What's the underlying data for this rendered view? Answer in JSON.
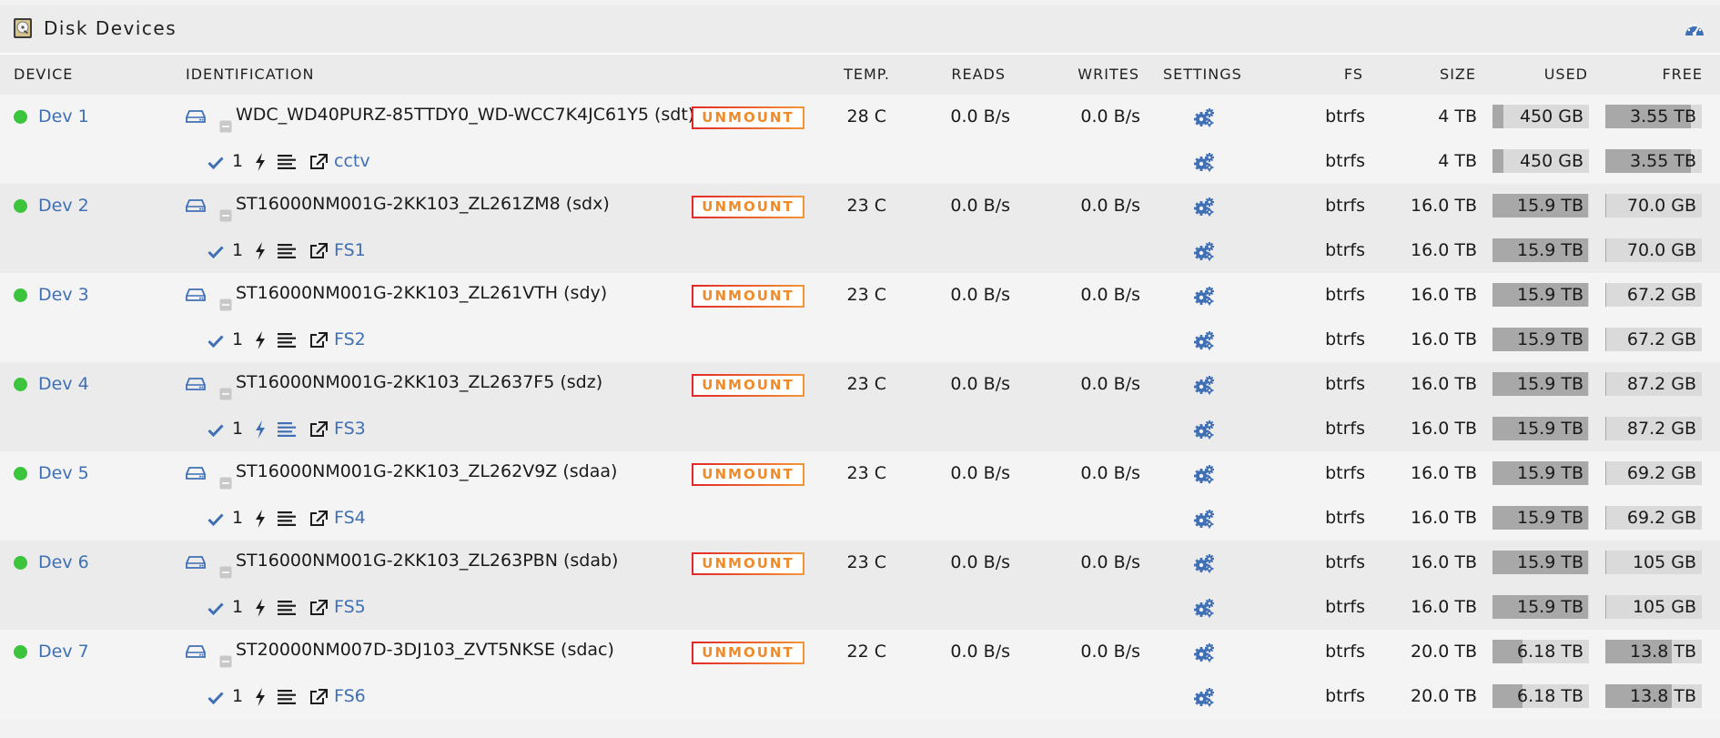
{
  "panel": {
    "title": "Disk Devices"
  },
  "columns": {
    "device": "DEVICE",
    "identification": "IDENTIFICATION",
    "temp": "TEMP.",
    "reads": "READS",
    "writes": "WRITES",
    "settings": "SETTINGS",
    "fs": "FS",
    "size": "SIZE",
    "used": "USED",
    "free": "FREE"
  },
  "colors": {
    "accent": "#3f6fb5",
    "online": "#3cc43c",
    "unmount_start": "#e22828",
    "unmount_end": "#f39636"
  },
  "devices": [
    {
      "name": "Dev 1",
      "identification": "WDC_WD40PURZ-85TTDY0_WD-WCC7K4JC61Y5 (sdt)",
      "action": "UNMOUNT",
      "temp": "28 C",
      "reads": "0.0 B/s",
      "writes": "0.0 B/s",
      "fs": "btrfs",
      "size": "4 TB",
      "used": "450 GB",
      "used_fraction": 0.11,
      "free": "3.55 TB",
      "free_fraction": 0.89,
      "share": {
        "count": "1",
        "name": "cctv",
        "fs": "btrfs",
        "size": "4 TB",
        "used": "450 GB",
        "free": "3.55 TB"
      }
    },
    {
      "name": "Dev 2",
      "identification": "ST16000NM001G-2KK103_ZL261ZM8 (sdx)",
      "action": "UNMOUNT",
      "temp": "23 C",
      "reads": "0.0 B/s",
      "writes": "0.0 B/s",
      "fs": "btrfs",
      "size": "16.0 TB",
      "used": "15.9 TB",
      "used_fraction": 0.99,
      "free": "70.0 GB",
      "free_fraction": 0.01,
      "share": {
        "count": "1",
        "name": "FS1",
        "fs": "btrfs",
        "size": "16.0 TB",
        "used": "15.9 TB",
        "free": "70.0 GB"
      }
    },
    {
      "name": "Dev 3",
      "identification": "ST16000NM001G-2KK103_ZL261VTH (sdy)",
      "action": "UNMOUNT",
      "temp": "23 C",
      "reads": "0.0 B/s",
      "writes": "0.0 B/s",
      "fs": "btrfs",
      "size": "16.0 TB",
      "used": "15.9 TB",
      "used_fraction": 0.99,
      "free": "67.2 GB",
      "free_fraction": 0.01,
      "share": {
        "count": "1",
        "name": "FS2",
        "fs": "btrfs",
        "size": "16.0 TB",
        "used": "15.9 TB",
        "free": "67.2 GB"
      }
    },
    {
      "name": "Dev 4",
      "identification": "ST16000NM001G-2KK103_ZL2637F5 (sdz)",
      "action": "UNMOUNT",
      "temp": "23 C",
      "reads": "0.0 B/s",
      "writes": "0.0 B/s",
      "fs": "btrfs",
      "size": "16.0 TB",
      "used": "15.9 TB",
      "used_fraction": 0.99,
      "free": "87.2 GB",
      "free_fraction": 0.01,
      "share": {
        "count": "1",
        "name": "FS3",
        "fs": "btrfs",
        "size": "16.0 TB",
        "used": "15.9 TB",
        "free": "87.2 GB",
        "highlight_icons": true
      }
    },
    {
      "name": "Dev 5",
      "identification": "ST16000NM001G-2KK103_ZL262V9Z (sdaa)",
      "action": "UNMOUNT",
      "temp": "23 C",
      "reads": "0.0 B/s",
      "writes": "0.0 B/s",
      "fs": "btrfs",
      "size": "16.0 TB",
      "used": "15.9 TB",
      "used_fraction": 0.99,
      "free": "69.2 GB",
      "free_fraction": 0.01,
      "share": {
        "count": "1",
        "name": "FS4",
        "fs": "btrfs",
        "size": "16.0 TB",
        "used": "15.9 TB",
        "free": "69.2 GB"
      }
    },
    {
      "name": "Dev 6",
      "identification": "ST16000NM001G-2KK103_ZL263PBN (sdab)",
      "action": "UNMOUNT",
      "temp": "23 C",
      "reads": "0.0 B/s",
      "writes": "0.0 B/s",
      "fs": "btrfs",
      "size": "16.0 TB",
      "used": "15.9 TB",
      "used_fraction": 0.99,
      "free": "105 GB",
      "free_fraction": 0.01,
      "share": {
        "count": "1",
        "name": "FS5",
        "fs": "btrfs",
        "size": "16.0 TB",
        "used": "15.9 TB",
        "free": "105 GB"
      }
    },
    {
      "name": "Dev 7",
      "identification": "ST20000NM007D-3DJ103_ZVT5NKSE (sdac)",
      "action": "UNMOUNT",
      "temp": "22 C",
      "reads": "0.0 B/s",
      "writes": "0.0 B/s",
      "fs": "btrfs",
      "size": "20.0 TB",
      "used": "6.18 TB",
      "used_fraction": 0.31,
      "free": "13.8 TB",
      "free_fraction": 0.69,
      "share": {
        "count": "1",
        "name": "FS6",
        "fs": "btrfs",
        "size": "20.0 TB",
        "used": "6.18 TB",
        "free": "13.8 TB"
      }
    }
  ]
}
